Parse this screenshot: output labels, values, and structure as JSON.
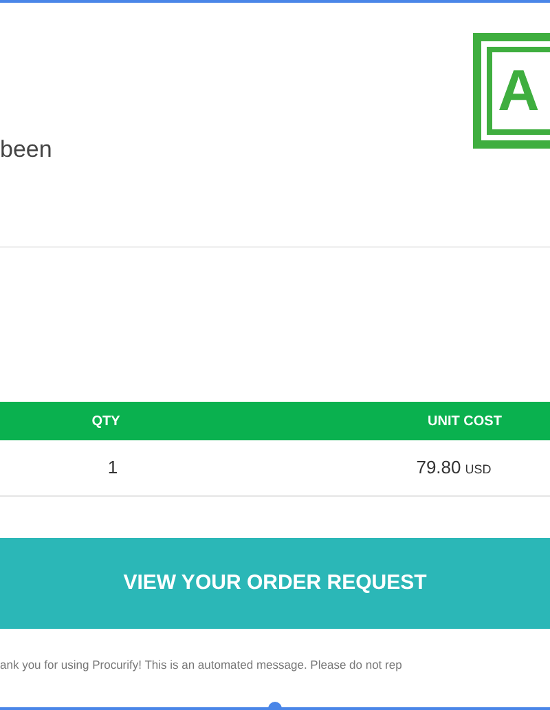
{
  "message": {
    "text_fragment": "been"
  },
  "stamp": {
    "text": "A"
  },
  "table": {
    "columns": [
      "QTY",
      "UNIT COST"
    ],
    "rows": [
      {
        "qty": "1",
        "unit_cost": "79.80",
        "currency": "USD"
      }
    ]
  },
  "action_button": {
    "label": "VIEW YOUR ORDER REQUEST"
  },
  "footer": {
    "text": "ank you for using Procurify! This is an automated message. Please do not rep"
  }
}
